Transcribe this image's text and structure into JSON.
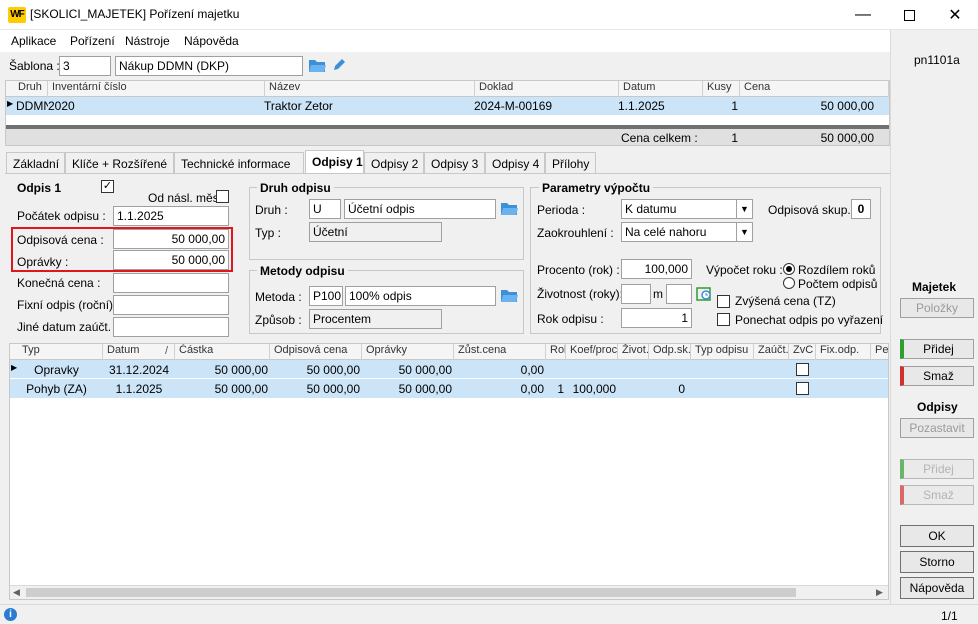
{
  "window": {
    "logo": "WF",
    "title": "[SKOLICI_MAJETEK] Pořízení majetku"
  },
  "menu": [
    "Aplikace",
    "Pořízení",
    "Nástroje",
    "Nápověda"
  ],
  "form_id": "pn1101a",
  "sablona": {
    "label": "Šablona :",
    "code": "3",
    "name": "Nákup DDMN (DKP)"
  },
  "main_table": {
    "columns": [
      "Druh",
      "Inventární číslo",
      "Název",
      "Doklad",
      "Datum",
      "Kusy",
      "Cena"
    ],
    "row": {
      "druh": "DDMN",
      "inv": "2020",
      "nazev": "Traktor Zetor",
      "doklad": "2024-M-00169",
      "datum": "1.1.2025",
      "kusy": "1",
      "cena": "50 000,00"
    },
    "total_label": "Cena celkem :",
    "total_kusy": "1",
    "total_cena": "50 000,00"
  },
  "tabs": [
    "Základní",
    "Klíče + Rozšířené",
    "Technické informace",
    "Odpisy 1",
    "Odpisy 2",
    "Odpisy 3",
    "Odpisy 4",
    "Přílohy"
  ],
  "odpis": {
    "title": "Odpis 1",
    "od_nasl": "Od násl. měs.",
    "pocatek_label": "Počátek odpisu :",
    "pocatek": "1.1.2025",
    "cena_label": "Odpisová cena :",
    "cena": "50 000,00",
    "opravky_label": "Oprávky :",
    "opravky": "50 000,00",
    "konecna_label": "Konečná cena :",
    "fixni_label": "Fixní odpis (roční) :",
    "jine_label": "Jiné datum zaúčt. :"
  },
  "druh_odpisu": {
    "title": "Druh odpisu",
    "druh_label": "Druh :",
    "druh_code": "U",
    "druh_name": "Účetní odpis",
    "typ_label": "Typ :",
    "typ": "Účetní"
  },
  "metody": {
    "title": "Metody odpisu",
    "metoda_label": "Metoda :",
    "metoda_code": "P100",
    "metoda_name": "100% odpis",
    "zpusob_label": "Způsob :",
    "zpusob": "Procentem"
  },
  "parametry": {
    "title": "Parametry výpočtu",
    "perioda_label": "Perioda :",
    "perioda": "K datumu",
    "zaokr_label": "Zaokrouhlení :",
    "zaokr": "Na celé nahoru",
    "skup_label": "Odpisová skup. :",
    "skup": "0",
    "procento_label": "Procento (rok) :",
    "procento": "100,000",
    "zivotnost_label": "Životnost (roky):",
    "m": "m",
    "rok_label": "Rok odpisu :",
    "rok": "1",
    "vypocet_label": "Výpočet roku :",
    "radio1": "Rozdílem roků",
    "radio2": "Počtem odpisů",
    "zvysena": "Zvýšená cena (TZ)",
    "ponechat": "Ponechat odpis po vyřazení"
  },
  "grid": {
    "columns": [
      "Typ",
      "Datum",
      "Částka",
      "Odpisová cena",
      "Oprávky",
      "Zůst.cena",
      "Rok",
      "Koef/proc",
      "Život.",
      "Odp.sk.",
      "Typ odpisu",
      "Zaúčt.",
      "ZvC",
      "Fix.odp.",
      "Per"
    ],
    "sort_mark": "/",
    "rows": [
      {
        "typ": "Opravky",
        "datum": "31.12.2024",
        "castka": "50 000,00",
        "cena": "50 000,00",
        "opravky": "50 000,00",
        "zust": "0,00",
        "rok": "",
        "koef": "",
        "odp": ""
      },
      {
        "typ": "Pohyb (ZA)",
        "datum": "1.1.2025",
        "castka": "50 000,00",
        "cena": "50 000,00",
        "opravky": "50 000,00",
        "zust": "0,00",
        "rok": "1",
        "koef": "100,000",
        "odp": "0"
      }
    ]
  },
  "right_panel": {
    "majetek": "Majetek",
    "polozky": "Položky",
    "pridej": "Přidej",
    "smaz": "Smaž",
    "odpisy": "Odpisy",
    "pozastavit": "Pozastavit",
    "pridej2": "Přidej",
    "smaz2": "Smaž",
    "ok": "OK",
    "storno": "Storno",
    "napoveda": "Nápověda"
  },
  "status": {
    "info": "i",
    "page": "1/1"
  },
  "colors": {
    "selected_row": "#cce4f7",
    "highlight_box": "#e0161e",
    "accent": "#ffcc00"
  }
}
